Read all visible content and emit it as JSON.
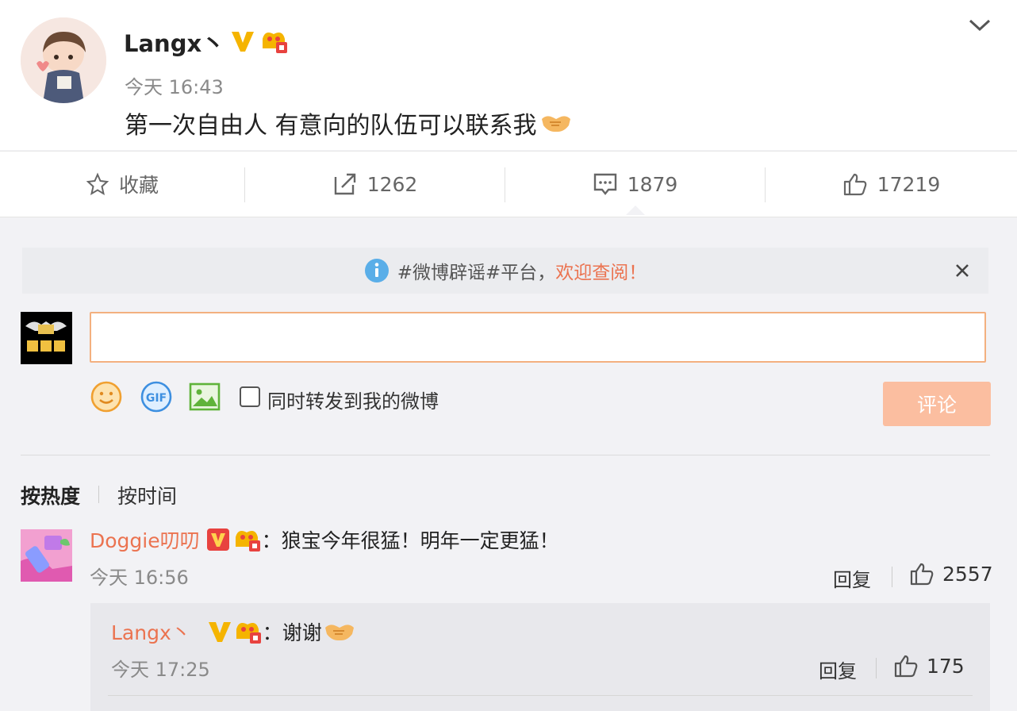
{
  "post": {
    "username": "Langx丶",
    "timestamp": "今天 16:43",
    "text": "第一次自由人  有意向的队伍可以联系我",
    "emoji": "handshake-emoji"
  },
  "actions": {
    "favorite": "收藏",
    "repost_count": "1262",
    "comment_count": "1879",
    "like_count": "17219"
  },
  "notice": {
    "prefix": "#微博辟谣#平台，",
    "highlight": "欢迎查阅！"
  },
  "composer": {
    "input_value": "",
    "checkbox_label": "同时转发到我的微博",
    "submit_label": "评论"
  },
  "sort": {
    "hot": "按热度",
    "time": "按时间"
  },
  "comments": [
    {
      "name": "Doggie叨叨",
      "text": "：狼宝今年很猛！明年一定更猛！",
      "time": "今天 16:56",
      "reply": "回复",
      "likes": "2557",
      "replies": [
        {
          "name": "Langx丶",
          "text": "：谢谢",
          "time": "今天 17:25",
          "reply": "回复",
          "likes": "175"
        }
      ]
    }
  ],
  "colors": {
    "accent": "#eb7350",
    "verified_gold": "#f5b400",
    "verified_red": "#e8423f",
    "submit_disabled": "#fbbea0"
  }
}
